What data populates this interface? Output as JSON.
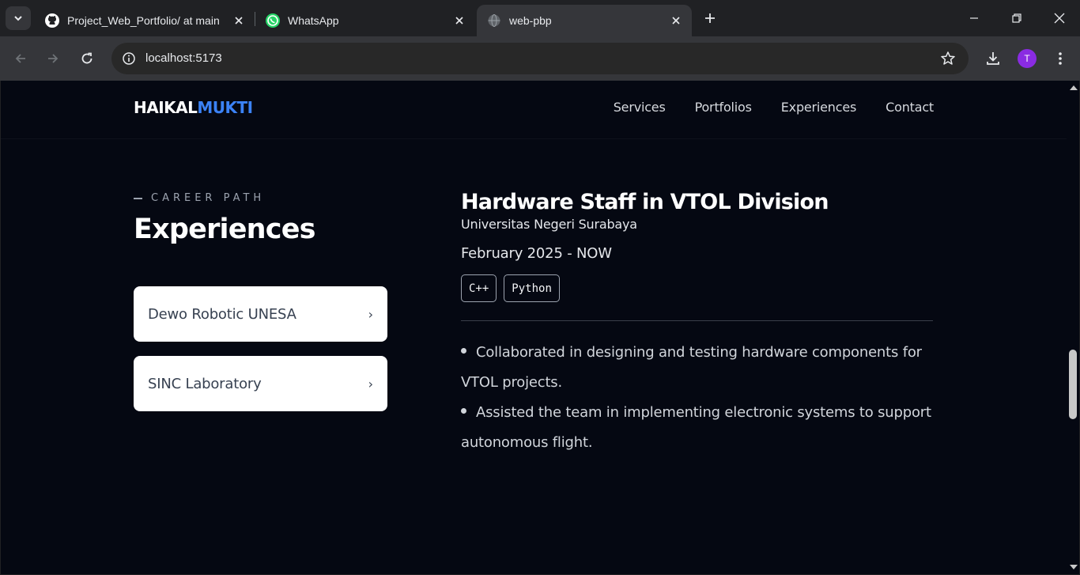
{
  "browser": {
    "tabs": [
      {
        "title": "Project_Web_Portfolio/ at main",
        "icon": "github-icon",
        "active": false
      },
      {
        "title": "WhatsApp",
        "icon": "whatsapp-icon",
        "active": false
      },
      {
        "title": "web-pbp",
        "icon": "globe-icon",
        "active": true
      }
    ],
    "url": "localhost:5173",
    "profile_initial": "T",
    "profile_color": "#8a2be2"
  },
  "site": {
    "logo_first": "HAIKAL",
    "logo_second": "MUKTI",
    "accent_color": "#3b82f6",
    "nav": [
      "Services",
      "Portfolios",
      "Experiences",
      "Contact"
    ]
  },
  "experiences": {
    "eyebrow": "CAREER PATH",
    "title": "Experiences",
    "items": [
      {
        "name": "Dewo Robotic UNESA",
        "chevron": "›"
      },
      {
        "name": "SINC Laboratory",
        "chevron": "›"
      }
    ],
    "detail": {
      "role": "Hardware Staff in VTOL Division",
      "organization": "Universitas Negeri Surabaya",
      "period": "February 2025 - NOW",
      "tags": [
        "C++",
        "Python"
      ],
      "bullets": [
        "Collaborated in designing and testing hardware components for VTOL projects.",
        "Assisted the team in implementing electronic systems to support autonomous flight."
      ]
    }
  }
}
